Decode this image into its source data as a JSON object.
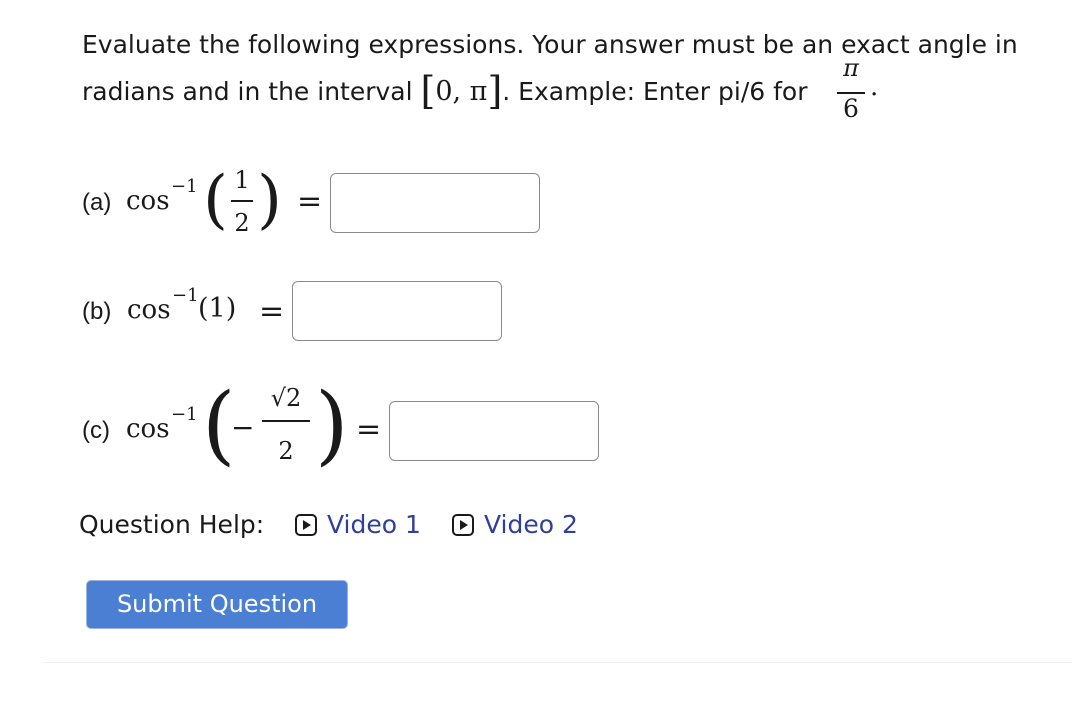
{
  "instructions": {
    "line1": "Evaluate the following expressions. Your answer must be an exact angle in",
    "line2_prefix": "radians and in the interval",
    "interval_open": "[",
    "interval_body": "0, π",
    "interval_close": "]",
    "line2_suffix": ". Example: Enter pi/6 for",
    "example_numerator": "π",
    "example_denominator": "6",
    "end_period": "."
  },
  "parts": [
    {
      "label": "(a)",
      "func": "cos",
      "exponent": "−1",
      "numerator": "1",
      "denominator": "2",
      "equals": "=",
      "answer": ""
    },
    {
      "label": "(b)",
      "func": "cos",
      "exponent": "−1",
      "argument": "(1)",
      "equals": "=",
      "answer": ""
    },
    {
      "label": "(c)",
      "func": "cos",
      "exponent": "−1",
      "sign": "−",
      "numerator": "√2",
      "denominator": "2",
      "equals": "=",
      "answer": ""
    }
  ],
  "help": {
    "label": "Question Help:",
    "links": [
      "Video 1",
      "Video 2"
    ],
    "icon": "play-video-icon"
  },
  "submit": {
    "label": "Submit Question"
  },
  "colors": {
    "link": "#2f3f9a",
    "button": "#4a7fd4"
  }
}
